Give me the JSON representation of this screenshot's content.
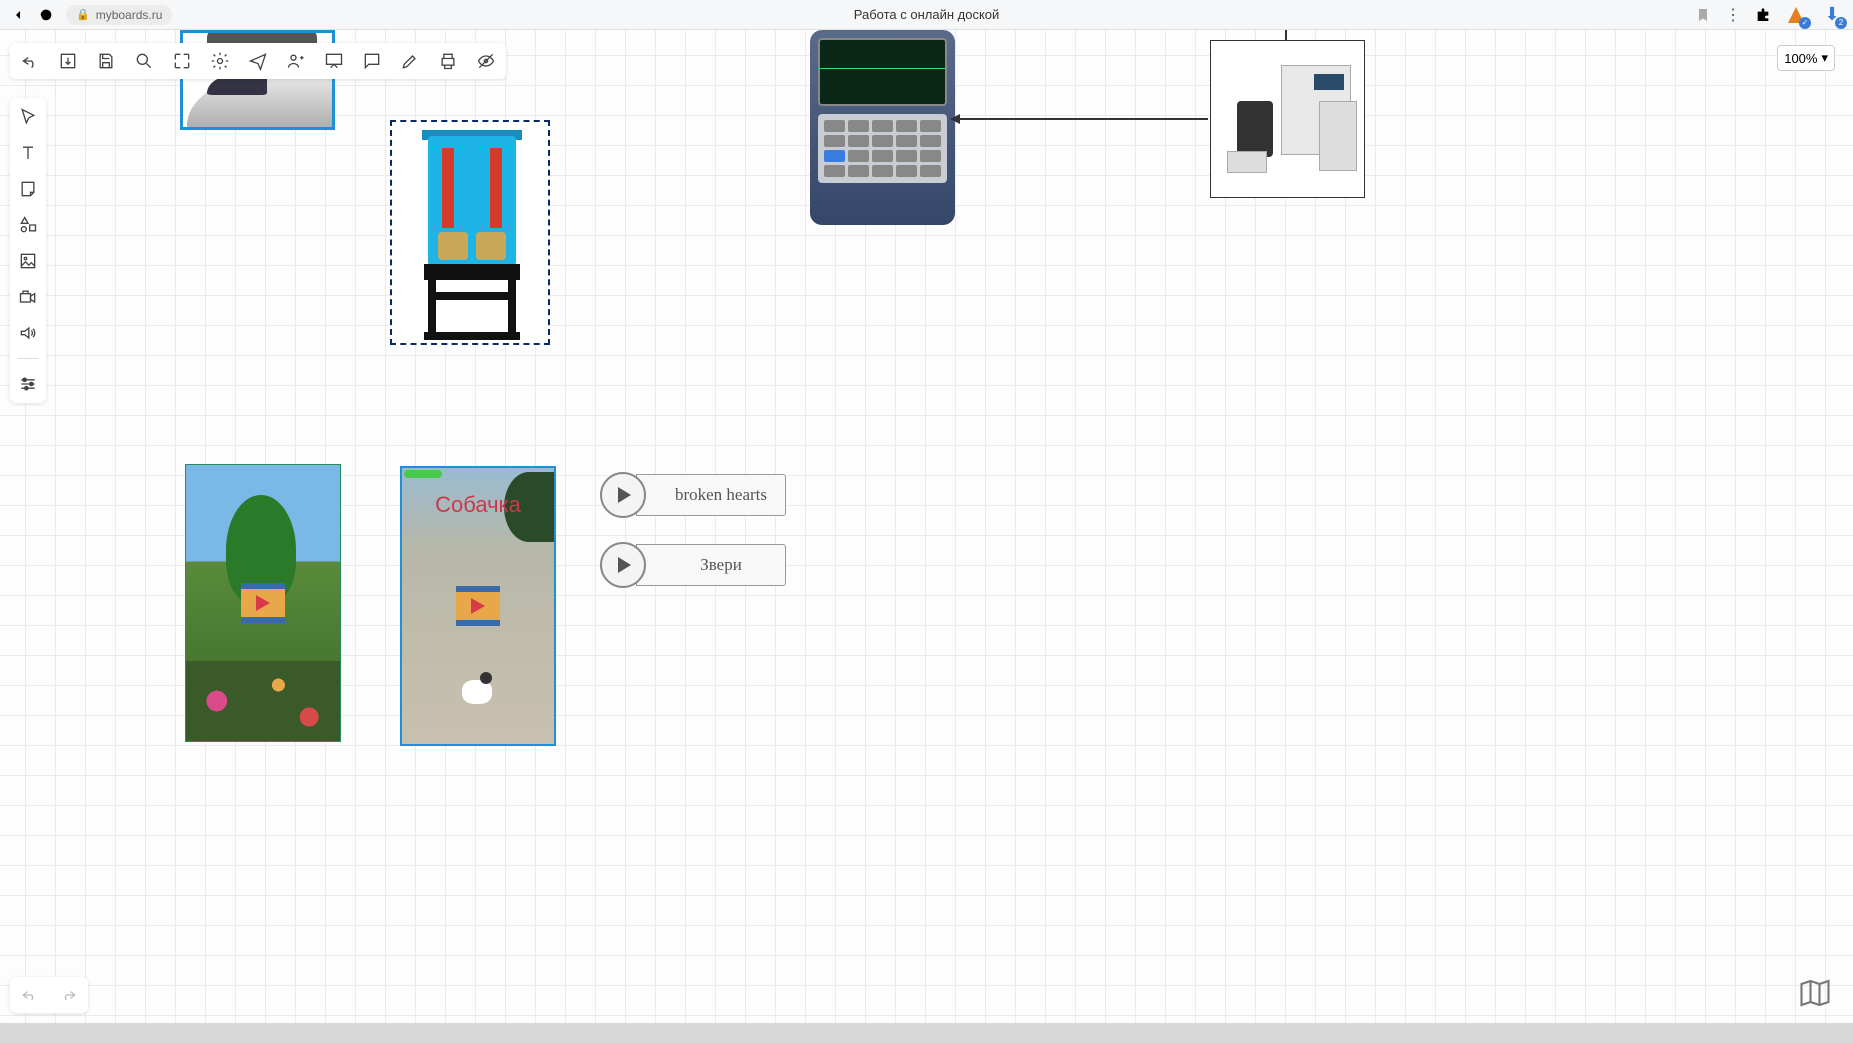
{
  "browser": {
    "url": "myboards.ru",
    "tab_title": "Работа с онлайн доской",
    "download_badge": "2"
  },
  "zoom": {
    "value": "100%"
  },
  "board": {
    "video2_label": "Собачка",
    "audio1_label": "broken hearts",
    "audio2_label": "Звери"
  },
  "icons": {
    "top": [
      "undo",
      "import",
      "save",
      "search",
      "selection",
      "settings",
      "send",
      "users",
      "view",
      "comment",
      "draw",
      "print",
      "visibility"
    ],
    "left": [
      "cursor",
      "text",
      "note",
      "shapes",
      "image",
      "video",
      "audio",
      "sliders"
    ]
  }
}
